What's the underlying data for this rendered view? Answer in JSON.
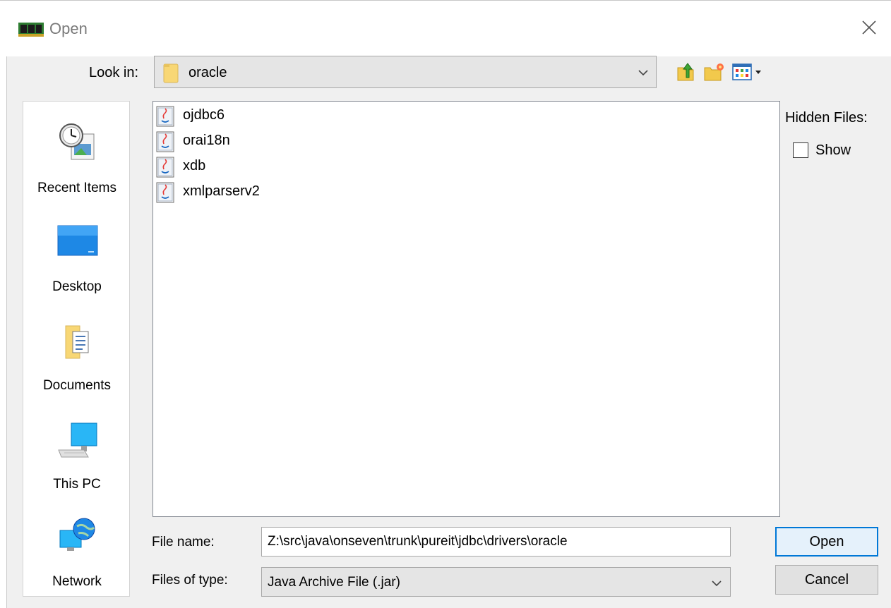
{
  "window": {
    "title": "Open"
  },
  "look_in": {
    "label": "Look in:",
    "value": "oracle"
  },
  "places": [
    {
      "label": "Recent Items",
      "icon": "recent-items-icon"
    },
    {
      "label": "Desktop",
      "icon": "desktop-icon"
    },
    {
      "label": "Documents",
      "icon": "documents-icon"
    },
    {
      "label": "This PC",
      "icon": "computer-icon"
    },
    {
      "label": "Network",
      "icon": "network-icon"
    }
  ],
  "files": [
    {
      "name": "ojdbc6",
      "icon": "jar-file-icon"
    },
    {
      "name": "orai18n",
      "icon": "jar-file-icon"
    },
    {
      "name": "xdb",
      "icon": "jar-file-icon"
    },
    {
      "name": "xmlparserv2",
      "icon": "jar-file-icon"
    }
  ],
  "hidden_files": {
    "label": "Hidden Files:",
    "show_label": "Show",
    "checked": false
  },
  "file_name": {
    "label": "File name:",
    "value": "Z:\\src\\java\\onseven\\trunk\\pureit\\jdbc\\drivers\\oracle"
  },
  "file_type": {
    "label": "Files of type:",
    "value": "Java Archive File (.jar)"
  },
  "buttons": {
    "open": "Open",
    "cancel": "Cancel"
  },
  "colors": {
    "accent": "#0078d7",
    "desktop_blue": "#1e88e5",
    "folder_yellow": "#f8d775"
  }
}
